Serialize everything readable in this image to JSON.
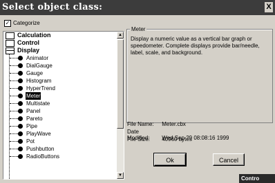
{
  "window": {
    "title": "Select object class:",
    "close_glyph": "X"
  },
  "categorize": {
    "label": "Categorize",
    "checked": true
  },
  "tree": {
    "categories": [
      "Calculation",
      "Control",
      "Display"
    ],
    "items": [
      "Animator",
      "DialGauge",
      "Gauge",
      "Histogram",
      "HyperTrend",
      "Meter",
      "Multistate",
      "Panel",
      "Pareto",
      "Pipe",
      "PlayWave",
      "Pot",
      "Pushbutton",
      "RadioButtons"
    ],
    "selected": "Meter"
  },
  "description": {
    "title": "Meter",
    "text": "Display a numeric value as a vertical bar graph or speedometer. Complete displays provide bar/needle, label, scale, and background."
  },
  "file_info": {
    "name_label": "File Name:",
    "name_value": "Meter.cbx",
    "modified_label": "Date Modified:",
    "modified_value": "Wed Sep 29 08:08:16 1999",
    "size_label": "File Size:",
    "size_value": "40960 bytes"
  },
  "buttons": {
    "ok": "Ok",
    "cancel": "Cancel"
  },
  "taskbar": {
    "label": "Contro"
  }
}
